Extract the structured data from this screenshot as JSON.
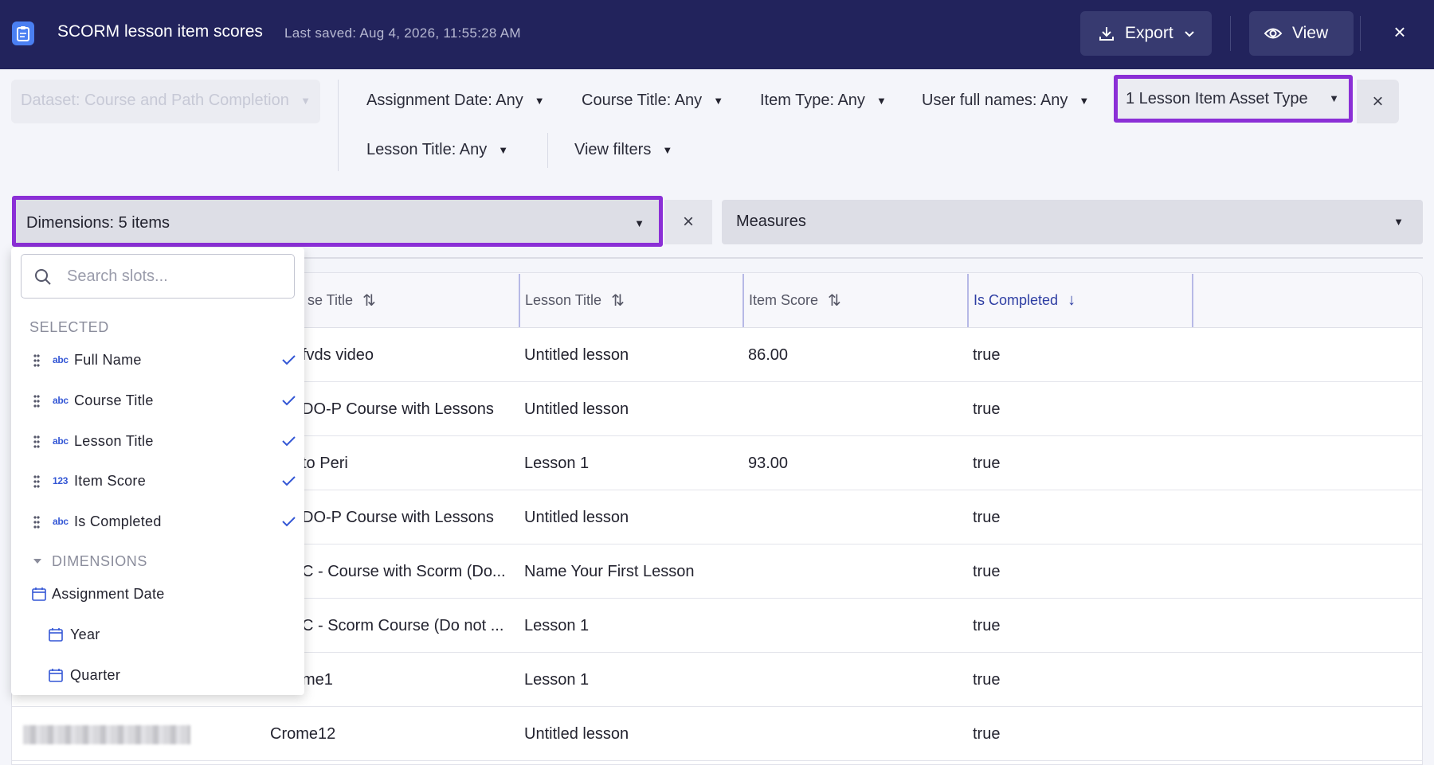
{
  "header": {
    "title": "SCORM lesson item scores",
    "last_saved": "Last saved: Aug 4, 2026, 11:55:28 AM",
    "export_label": "Export",
    "view_label": "View"
  },
  "filters": {
    "dataset": "Dataset: Course and Path Completion",
    "assignment_date": "Assignment Date: Any",
    "course_title": "Course Title: Any",
    "item_type": "Item Type: Any",
    "user_full_names": "User full names: Any",
    "asset_type": "1 Lesson Item Asset Type",
    "lesson_title": "Lesson Title: Any",
    "view_filters": "View filters"
  },
  "dimensions_label": "Dimensions: 5 items",
  "measures_label": "Measures",
  "panel": {
    "search_placeholder": "Search slots...",
    "selected_heading": "SELECTED",
    "selected": [
      {
        "tag": "abc",
        "label": "Full Name"
      },
      {
        "tag": "abc",
        "label": "Course Title"
      },
      {
        "tag": "abc",
        "label": "Lesson Title"
      },
      {
        "tag": "123",
        "label": "Item Score"
      },
      {
        "tag": "abc",
        "label": "Is Completed"
      }
    ],
    "dimensions_heading": "DIMENSIONS",
    "dimensions": [
      {
        "label": "Assignment Date"
      },
      {
        "label": "Year"
      },
      {
        "label": "Quarter"
      }
    ]
  },
  "table": {
    "columns": [
      {
        "label": "se Title",
        "sort": "⇅"
      },
      {
        "label": "Lesson Title",
        "sort": "⇅"
      },
      {
        "label": "Item Score",
        "sort": "⇅"
      },
      {
        "label": "Is Completed",
        "sort": "↓"
      }
    ],
    "rows": [
      {
        "course": "fvds video",
        "lesson": "Untitled lesson",
        "score": "86.00",
        "completed": "true"
      },
      {
        "course": "DO-P Course with Lessons",
        "lesson": "Untitled lesson",
        "score": "",
        "completed": "true"
      },
      {
        "course": "to Peri",
        "lesson": "Lesson 1",
        "score": "93.00",
        "completed": "true"
      },
      {
        "course": "DO-P Course with Lessons",
        "lesson": "Untitled lesson",
        "score": "",
        "completed": "true"
      },
      {
        "course": "C - Course with Scorm (Do...",
        "lesson": "Name Your First Lesson",
        "score": "",
        "completed": "true"
      },
      {
        "course": "C - Scorm Course (Do not ...",
        "lesson": "Lesson 1",
        "score": "",
        "completed": "true"
      },
      {
        "course": "me1",
        "lesson": "Lesson 1",
        "score": "",
        "completed": "true"
      },
      {
        "course": "Crome12",
        "lesson": "Untitled lesson",
        "score": "",
        "completed": "true"
      }
    ]
  },
  "colors": {
    "header_bg": "#22235c",
    "highlight": "#8b2fd6",
    "accent_blue": "#3457d5"
  }
}
